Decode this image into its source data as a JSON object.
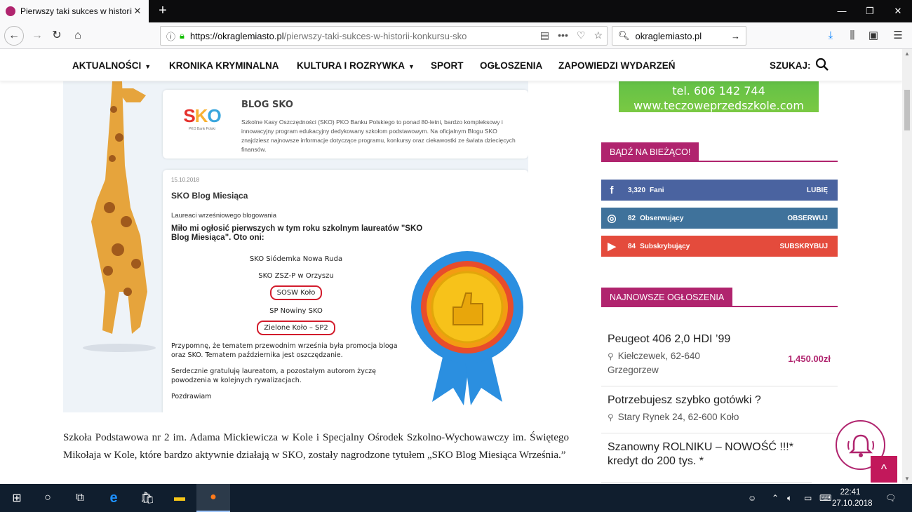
{
  "browser": {
    "tab_title": "Pierwszy taki sukces w historii k",
    "url_domain": "https://okraglemiasto.pl",
    "url_path": "/pierwszy-taki-sukces-w-historii-konkursu-sko",
    "search_value": "okraglemiasto.pl"
  },
  "sitenav": {
    "items": [
      "AKTUALNOŚCI",
      "KRONIKA KRYMINALNA",
      "KULTURA I ROZRYWKA",
      "SPORT",
      "OGŁOSZENIA",
      "ZAPOWIEDZI WYDARZEŃ"
    ],
    "search_label": "SZUKAJ:"
  },
  "article_image": {
    "sko_logo": "SKO",
    "sko_logo_sub": "PKO Bank Polski",
    "blog_title": "BLOG SKO",
    "blog_desc": "Szkolne Kasy Oszczędności (SKO) PKO Banku Polskiego to ponad 80-letni, bardzo kompleksowy i innowacyjny program edukacyjny dedykowany szkołom podstawowym. Na oficjalnym Blogu SKO znajdziesz najnowsze informacje dotyczące programu, konkursy oraz ciekawostki ze świata dziecięcych finansów.",
    "post_date": "15.10.2018",
    "post_title": "SKO Blog Miesiąca",
    "post_sub": "Laureaci wrześniowego blogowania",
    "post_lead": "Miło mi ogłosić pierwszych w tym roku szkolnym laureatów \"SKO Blog Miesiąca\". Oto oni:",
    "laureates": [
      "SKO Siódemka Nowa Ruda",
      "SKO ZSZ-P w Orzyszu",
      "SOSW Koło",
      "SP Nowiny SKO",
      "Zielone Koło – SP2"
    ],
    "para1": "Przypomnę, że tematem przewodnim września była promocja bloga oraz SKO. Tematem października jest oszczędzanie.",
    "para2": "Serdecznie gratuluję laureatom, a pozostałym autorom życzę powodzenia w kolejnych rywalizacjach.",
    "para3": "Pozdrawiam"
  },
  "article_text": "Szkoła Podstawowa nr 2 im. Adama Mickiewicza w Kole i Specjalny Ośrodek Szkolno-Wychowawczy im. Świętego Mikołaja w Kole, które bardzo aktywnie działają w SKO, zostały nagrodzone tytułem „SKO Blog Miesiąca Września.”",
  "sidebar": {
    "ad_line1": "tel. 606 142 744",
    "ad_line2": "www.teczoweprzedszkole.com",
    "section1": "BĄDŹ NA BIEŻĄCO!",
    "social": [
      {
        "count": "3,320",
        "label": "Fani",
        "action": "LUBIĘ",
        "color": "#4a63a0"
      },
      {
        "count": "82",
        "label": "Obserwujący",
        "action": "OBSERWUJ",
        "color": "#3f729b"
      },
      {
        "count": "84",
        "label": "Subskrybujący",
        "action": "SUBSKRYBUJ",
        "color": "#e44b3c"
      }
    ],
    "section2": "NAJNOWSZE OGŁOSZENIA",
    "ads": [
      {
        "title": "Peugeot 406 2,0 HDI ’99",
        "loc": "Kiełczewek, 62-640 Grzegorzew",
        "price": "1,450.00zł"
      },
      {
        "title": "Potrzebujesz szybko gotówki ?",
        "loc": "Stary Rynek 24, 62-600 Koło",
        "price": ""
      },
      {
        "title": "Szanowny ROLNIKU – NOWOŚĆ !!!* kredyt do 200 tys. *",
        "loc": "",
        "price": ""
      }
    ]
  },
  "taskbar": {
    "time": "22:41",
    "date": "27.10.2018"
  },
  "colors": {
    "accent": "#b0246e",
    "brand_green": "#4bb84a"
  }
}
